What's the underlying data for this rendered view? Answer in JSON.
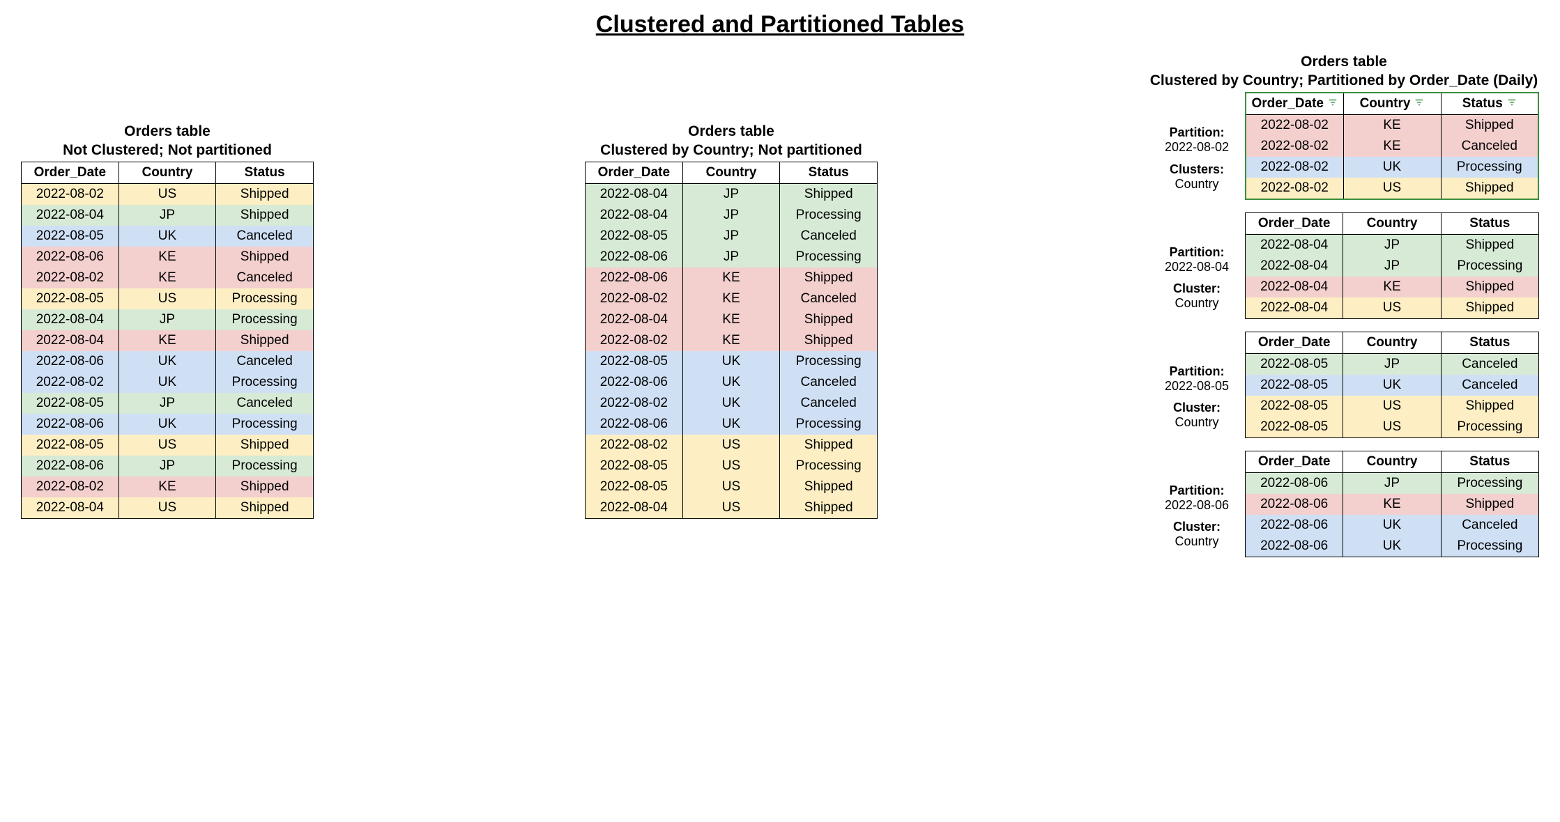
{
  "title": "Clustered and Partitioned Tables",
  "columns": [
    "Order_Date",
    "Country",
    "Status"
  ],
  "table1": {
    "title1": "Orders table",
    "title2": "Not Clustered; Not partitioned",
    "rows": [
      {
        "d": "2022-08-02",
        "c": "US",
        "s": "Shipped",
        "cls": "c-us"
      },
      {
        "d": "2022-08-04",
        "c": "JP",
        "s": "Shipped",
        "cls": "c-jp"
      },
      {
        "d": "2022-08-05",
        "c": "UK",
        "s": "Canceled",
        "cls": "c-uk"
      },
      {
        "d": "2022-08-06",
        "c": "KE",
        "s": "Shipped",
        "cls": "c-ke"
      },
      {
        "d": "2022-08-02",
        "c": "KE",
        "s": "Canceled",
        "cls": "c-ke"
      },
      {
        "d": "2022-08-05",
        "c": "US",
        "s": "Processing",
        "cls": "c-us"
      },
      {
        "d": "2022-08-04",
        "c": "JP",
        "s": "Processing",
        "cls": "c-jp"
      },
      {
        "d": "2022-08-04",
        "c": "KE",
        "s": "Shipped",
        "cls": "c-ke"
      },
      {
        "d": "2022-08-06",
        "c": "UK",
        "s": "Canceled",
        "cls": "c-uk"
      },
      {
        "d": "2022-08-02",
        "c": "UK",
        "s": "Processing",
        "cls": "c-uk"
      },
      {
        "d": "2022-08-05",
        "c": "JP",
        "s": "Canceled",
        "cls": "c-jp"
      },
      {
        "d": "2022-08-06",
        "c": "UK",
        "s": "Processing",
        "cls": "c-uk"
      },
      {
        "d": "2022-08-05",
        "c": "US",
        "s": "Shipped",
        "cls": "c-us"
      },
      {
        "d": "2022-08-06",
        "c": "JP",
        "s": "Processing",
        "cls": "c-jp"
      },
      {
        "d": "2022-08-02",
        "c": "KE",
        "s": "Shipped",
        "cls": "c-ke"
      },
      {
        "d": "2022-08-04",
        "c": "US",
        "s": "Shipped",
        "cls": "c-us"
      }
    ]
  },
  "table2": {
    "title1": "Orders table",
    "title2": "Clustered by Country; Not partitioned",
    "rows": [
      {
        "d": "2022-08-04",
        "c": "JP",
        "s": "Shipped",
        "cls": "c-jp"
      },
      {
        "d": "2022-08-04",
        "c": "JP",
        "s": "Processing",
        "cls": "c-jp"
      },
      {
        "d": "2022-08-05",
        "c": "JP",
        "s": "Canceled",
        "cls": "c-jp"
      },
      {
        "d": "2022-08-06",
        "c": "JP",
        "s": "Processing",
        "cls": "c-jp"
      },
      {
        "d": "2022-08-06",
        "c": "KE",
        "s": "Shipped",
        "cls": "c-ke"
      },
      {
        "d": "2022-08-02",
        "c": "KE",
        "s": "Canceled",
        "cls": "c-ke"
      },
      {
        "d": "2022-08-04",
        "c": "KE",
        "s": "Shipped",
        "cls": "c-ke"
      },
      {
        "d": "2022-08-02",
        "c": "KE",
        "s": "Shipped",
        "cls": "c-ke"
      },
      {
        "d": "2022-08-05",
        "c": "UK",
        "s": "Processing",
        "cls": "c-uk"
      },
      {
        "d": "2022-08-06",
        "c": "UK",
        "s": "Canceled",
        "cls": "c-uk"
      },
      {
        "d": "2022-08-02",
        "c": "UK",
        "s": "Canceled",
        "cls": "c-uk"
      },
      {
        "d": "2022-08-06",
        "c": "UK",
        "s": "Processing",
        "cls": "c-uk"
      },
      {
        "d": "2022-08-02",
        "c": "US",
        "s": "Shipped",
        "cls": "c-us"
      },
      {
        "d": "2022-08-05",
        "c": "US",
        "s": "Processing",
        "cls": "c-us"
      },
      {
        "d": "2022-08-05",
        "c": "US",
        "s": "Shipped",
        "cls": "c-us"
      },
      {
        "d": "2022-08-04",
        "c": "US",
        "s": "Shipped",
        "cls": "c-us"
      }
    ]
  },
  "table3": {
    "title1": "Orders table",
    "title2": "Clustered by Country; Partitioned by Order_Date (Daily)",
    "side_labels": {
      "partition": "Partition:",
      "partition_plural": "Partition:",
      "clusters": "Clusters:",
      "cluster": "Cluster:",
      "cluster_val": "Country"
    },
    "partitions": [
      {
        "part_val": "2022-08-02",
        "side_part": "Partition:",
        "side_clust": "Clusters:",
        "rows": [
          {
            "d": "2022-08-02",
            "c": "KE",
            "s": "Shipped",
            "cls": "c-ke"
          },
          {
            "d": "2022-08-02",
            "c": "KE",
            "s": "Canceled",
            "cls": "c-ke"
          },
          {
            "d": "2022-08-02",
            "c": "UK",
            "s": "Processing",
            "cls": "c-uk"
          },
          {
            "d": "2022-08-02",
            "c": "US",
            "s": "Shipped",
            "cls": "c-us"
          }
        ],
        "green": true
      },
      {
        "part_val": "2022-08-04",
        "side_part": "Partition:",
        "side_clust": "Cluster:",
        "rows": [
          {
            "d": "2022-08-04",
            "c": "JP",
            "s": "Shipped",
            "cls": "c-jp"
          },
          {
            "d": "2022-08-04",
            "c": "JP",
            "s": "Processing",
            "cls": "c-jp"
          },
          {
            "d": "2022-08-04",
            "c": "KE",
            "s": "Shipped",
            "cls": "c-ke"
          },
          {
            "d": "2022-08-04",
            "c": "US",
            "s": "Shipped",
            "cls": "c-us"
          }
        ]
      },
      {
        "part_val": "2022-08-05",
        "side_part": "Partition:",
        "side_clust": "Cluster:",
        "rows": [
          {
            "d": "2022-08-05",
            "c": "JP",
            "s": "Canceled",
            "cls": "c-jp"
          },
          {
            "d": "2022-08-05",
            "c": "UK",
            "s": "Canceled",
            "cls": "c-uk"
          },
          {
            "d": "2022-08-05",
            "c": "US",
            "s": "Shipped",
            "cls": "c-us"
          },
          {
            "d": "2022-08-05",
            "c": "US",
            "s": "Processing",
            "cls": "c-us"
          }
        ]
      },
      {
        "part_val": "2022-08-06",
        "side_part": "Partition:",
        "side_clust": "Cluster:",
        "rows": [
          {
            "d": "2022-08-06",
            "c": "JP",
            "s": "Processing",
            "cls": "c-jp"
          },
          {
            "d": "2022-08-06",
            "c": "KE",
            "s": "Shipped",
            "cls": "c-ke"
          },
          {
            "d": "2022-08-06",
            "c": "UK",
            "s": "Canceled",
            "cls": "c-uk"
          },
          {
            "d": "2022-08-06",
            "c": "UK",
            "s": "Processing",
            "cls": "c-uk"
          }
        ]
      }
    ]
  }
}
